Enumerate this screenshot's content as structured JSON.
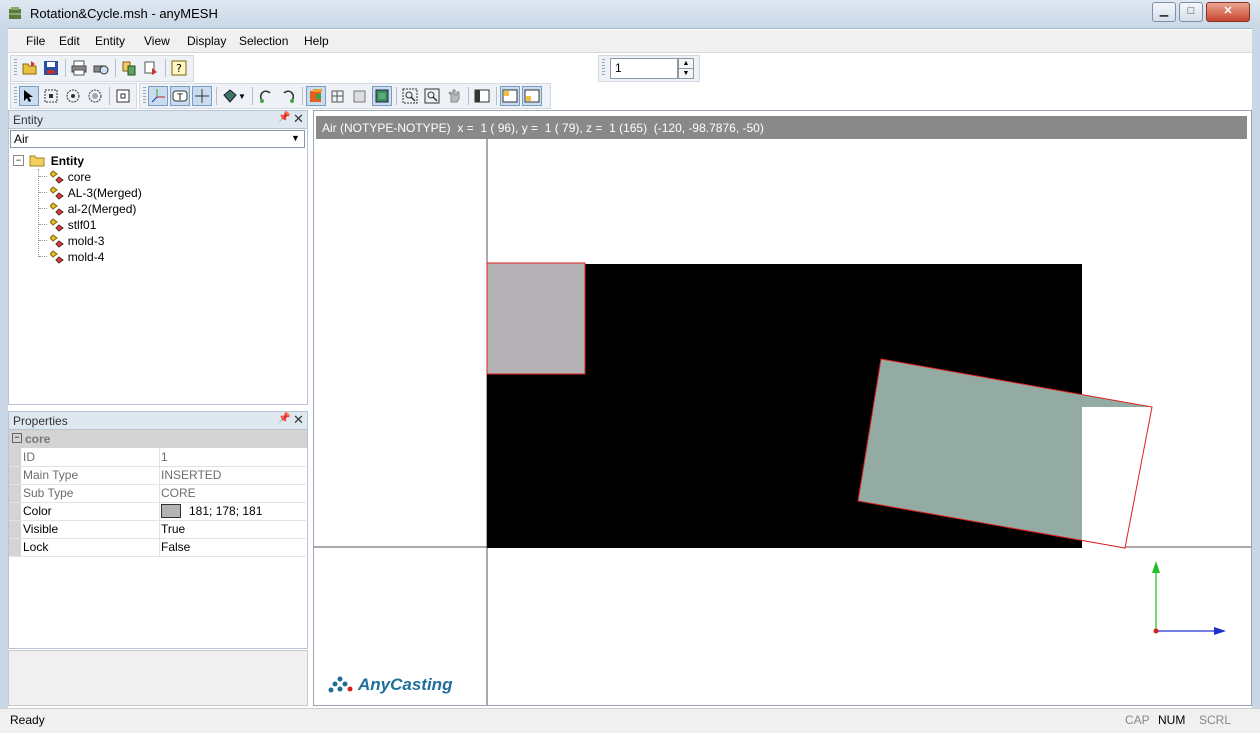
{
  "window": {
    "title": "Rotation&Cycle.msh - anyMESH",
    "minimize_glyph": "▁",
    "maximize_glyph": "□",
    "close_glyph": "✕"
  },
  "menu": [
    "File",
    "Edit",
    "Entity",
    "View",
    "Display",
    "Selection",
    "Help"
  ],
  "toolbar": {
    "spin_value": "1"
  },
  "entity_panel": {
    "title": "Entity",
    "pin_glyph": "📌",
    "close_glyph": "✕",
    "combo_value": "Air",
    "root_label": "Entity",
    "items": [
      "core",
      "AL-3(Merged)",
      "al-2(Merged)",
      "stlf01",
      "mold-3",
      "mold-4"
    ]
  },
  "properties_panel": {
    "title": "Properties",
    "pin_glyph": "📌",
    "close_glyph": "✕",
    "group_label": "core",
    "rows": [
      {
        "name": "ID",
        "value": "1"
      },
      {
        "name": "Main Type",
        "value": "INSERTED"
      },
      {
        "name": "Sub Type",
        "value": "CORE"
      },
      {
        "name": "Color",
        "value": "181; 178; 181"
      },
      {
        "name": "Visible",
        "value": "True"
      },
      {
        "name": "Lock",
        "value": "False"
      }
    ],
    "color_swatch": "#b5b2b5"
  },
  "viewport": {
    "info_text": "Air (NOTYPE-NOTYPE)  x =  1 ( 96), y =  1 ( 79), z =  1 (165)  (-120, -98.7876, -50)",
    "logo_text": "AnyCasting",
    "colors": {
      "mold": "#000000",
      "core": "#b5b2b5",
      "rotated_part": "#94aba3",
      "outline": "#e02020",
      "axis_y": "#20c020",
      "axis_x": "#2030d0",
      "logo": "#1f6e9a"
    }
  },
  "status": {
    "text": "Ready",
    "cap": "CAP",
    "num": "NUM",
    "scrl": "SCRL"
  }
}
